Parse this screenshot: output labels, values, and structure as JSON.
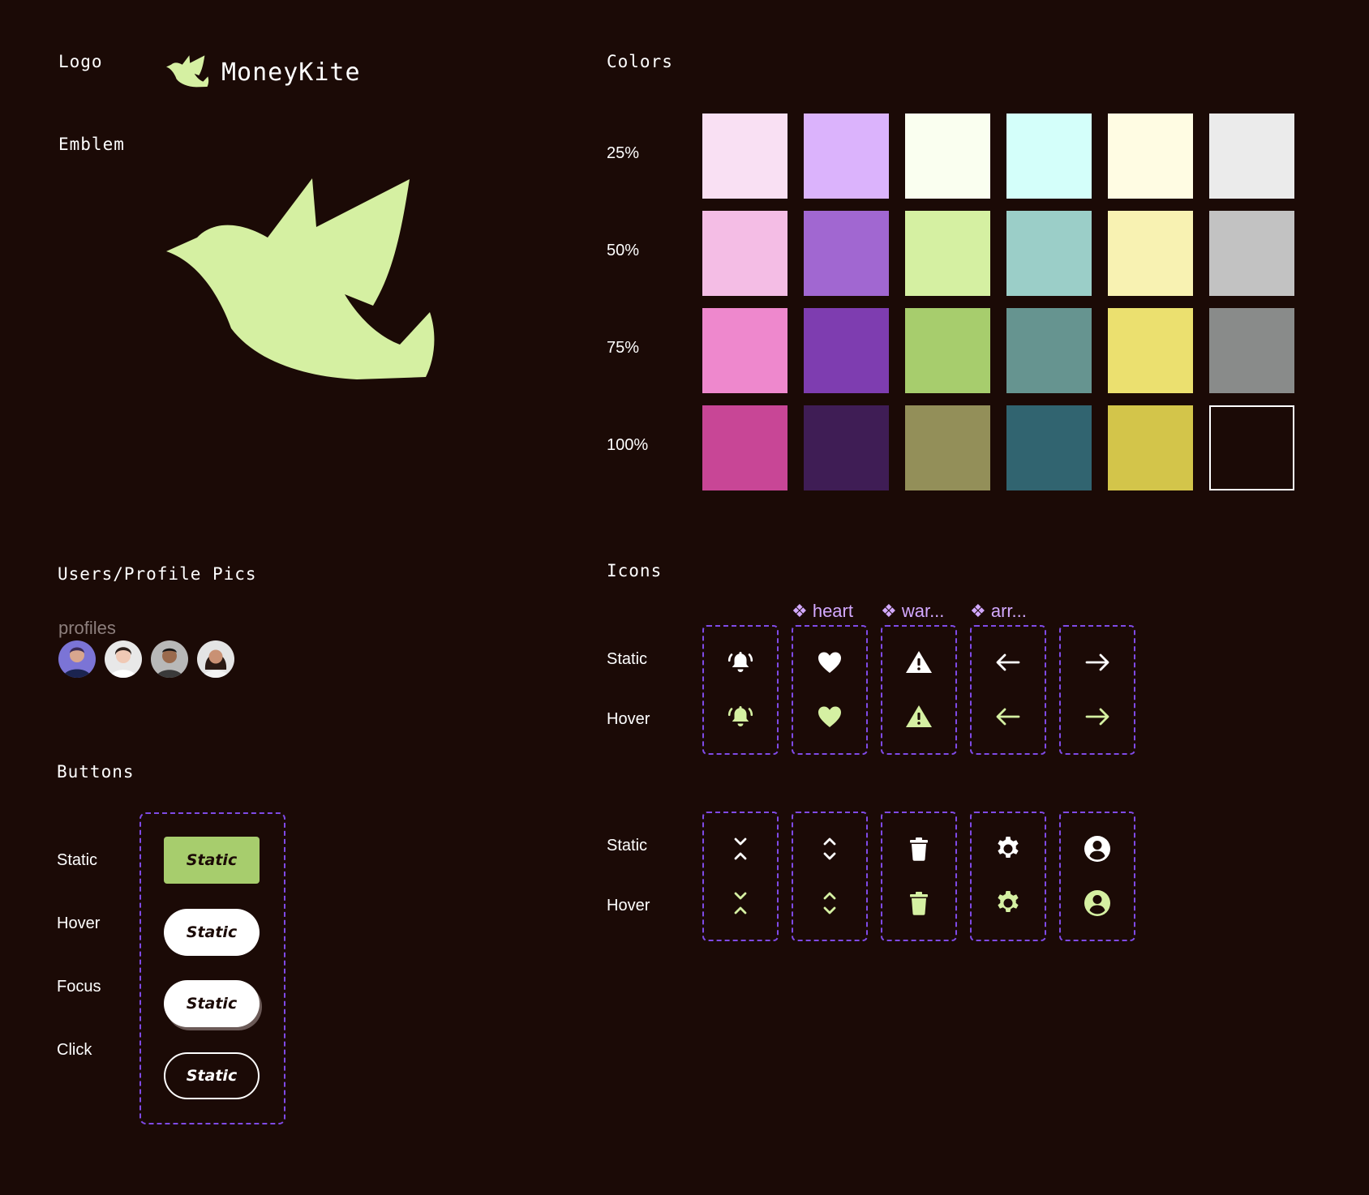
{
  "logo": {
    "label": "Logo",
    "brand_name": "MoneyKite"
  },
  "emblem": {
    "label": "Emblem"
  },
  "colors": {
    "label": "Colors",
    "rows": [
      {
        "label": "25%",
        "swatches": [
          "#f9e0f3",
          "#dbb3fc",
          "#fafff0",
          "#d4fffa",
          "#fffce3",
          "#ebebeb"
        ]
      },
      {
        "label": "50%",
        "swatches": [
          "#f4bde5",
          "#a167d1",
          "#d5f0a2",
          "#9bcec8",
          "#f8f2b2",
          "#c2c2c2"
        ]
      },
      {
        "label": "75%",
        "swatches": [
          "#ee88cd",
          "#7e3db0",
          "#a7cd6d",
          "#669490",
          "#ebe06f",
          "#898b8a"
        ]
      },
      {
        "label": "100%",
        "swatches": [
          "#c84696",
          "#3f1d55",
          "#938f59",
          "#316470",
          "#d3c54a",
          "#1b0a06"
        ]
      }
    ]
  },
  "profiles": {
    "section_label": "Users/Profile Pics",
    "group_label": "profiles"
  },
  "buttons": {
    "section_label": "Buttons",
    "states": [
      {
        "label": "Static",
        "button_text": "Static"
      },
      {
        "label": "Hover",
        "button_text": "Static"
      },
      {
        "label": "Focus",
        "button_text": "Static"
      },
      {
        "label": "Click",
        "button_text": "Static"
      }
    ]
  },
  "icons": {
    "section_label": "Icons",
    "component_labels": [
      "❖ heart",
      "❖ war...",
      "❖ arr..."
    ],
    "row1": {
      "static_label": "Static",
      "hover_label": "Hover",
      "icons": [
        "bell-icon",
        "heart-icon",
        "warning-icon",
        "arrow-left-icon",
        "arrow-right-icon"
      ]
    },
    "row2": {
      "static_label": "Static",
      "hover_label": "Hover",
      "icons": [
        "chevrons-collapse-icon",
        "chevrons-expand-icon",
        "trash-icon",
        "gear-icon",
        "user-circle-icon"
      ]
    },
    "static_color": "#ffffff",
    "hover_color": "#d5f0a2"
  },
  "palette": {
    "background": "#1b0a06",
    "accent": "#d5f0a2",
    "primary_button": "#a7cd6d",
    "dashed_border": "#7f4ae6",
    "component_label": "#d3a9ff"
  }
}
